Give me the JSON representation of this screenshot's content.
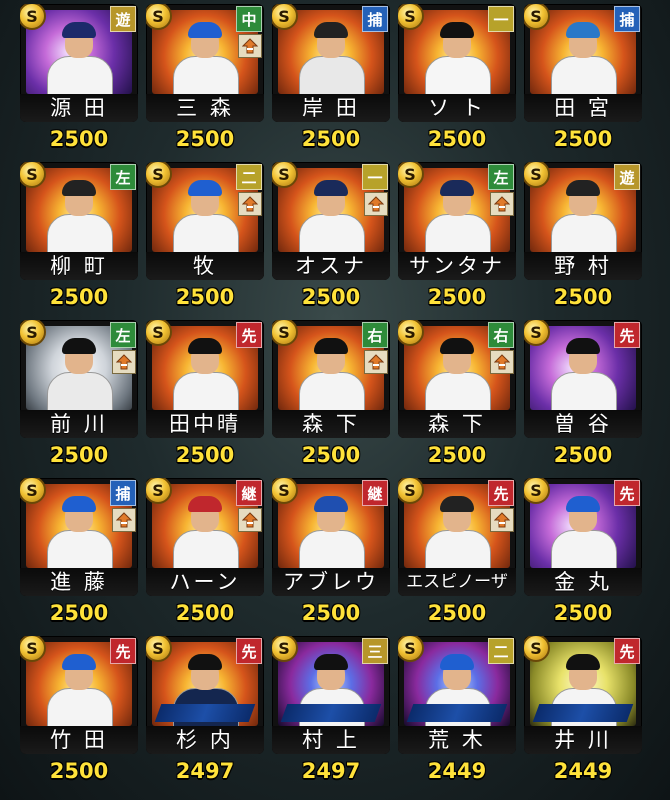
{
  "coin_symbol": "S",
  "icons": {
    "coin": "coin-s-icon",
    "upgrade": "upgrade-arrow-icon"
  },
  "colors": {
    "rating": "#ffe23a",
    "starter": "#c0272d",
    "catcher": "#2461b8",
    "outfield": "#2e8b3a",
    "infield": "#b7962a"
  },
  "players": [
    {
      "name": "源 田",
      "rating": "2500",
      "position": "遊",
      "pos_class": "shortstop",
      "bg": "purple",
      "cap": "#1c2a6a",
      "uniform": "#f4f4f4",
      "upgrade": false
    },
    {
      "name": "三 森",
      "rating": "2500",
      "position": "中",
      "pos_class": "center",
      "bg": "gold",
      "cap": "#1f5fd0",
      "uniform": "#f4f4f4",
      "upgrade": true
    },
    {
      "name": "岸 田",
      "rating": "2500",
      "position": "捕",
      "pos_class": "catcher",
      "bg": "gold",
      "cap": "#222",
      "uniform": "#e8e8e8",
      "upgrade": false
    },
    {
      "name": "ソ ト",
      "rating": "2500",
      "position": "一",
      "pos_class": "first",
      "bg": "gold",
      "cap": "#111",
      "uniform": "#f6f6f6",
      "upgrade": false
    },
    {
      "name": "田 宮",
      "rating": "2500",
      "position": "捕",
      "pos_class": "catcher",
      "bg": "gold",
      "cap": "#2a78c8",
      "uniform": "#f4f4f4",
      "upgrade": false
    },
    {
      "name": "柳 町",
      "rating": "2500",
      "position": "左",
      "pos_class": "left",
      "bg": "gold",
      "cap": "#222",
      "uniform": "#f4f4f4",
      "upgrade": false
    },
    {
      "name": "牧",
      "rating": "2500",
      "position": "二",
      "pos_class": "second",
      "bg": "gold",
      "cap": "#1f5fd0",
      "uniform": "#f4f4f4",
      "upgrade": true
    },
    {
      "name": "オスナ",
      "rating": "2500",
      "position": "一",
      "pos_class": "first",
      "bg": "gold",
      "cap": "#1a2a5a",
      "uniform": "#f4f4f4",
      "upgrade": true
    },
    {
      "name": "サンタナ",
      "rating": "2500",
      "position": "左",
      "pos_class": "left",
      "bg": "gold",
      "cap": "#1a2a5a",
      "uniform": "#f4f4f4",
      "upgrade": true
    },
    {
      "name": "野 村",
      "rating": "2500",
      "position": "遊",
      "pos_class": "shortstop",
      "bg": "gold",
      "cap": "#222",
      "uniform": "#f4f4f4",
      "upgrade": false
    },
    {
      "name": "前 川",
      "rating": "2500",
      "position": "左",
      "pos_class": "left",
      "bg": "silver",
      "cap": "#111",
      "uniform": "#eaeaea",
      "upgrade": true
    },
    {
      "name": "田中晴",
      "rating": "2500",
      "position": "先",
      "pos_class": "starter",
      "bg": "gold",
      "cap": "#111",
      "uniform": "#f4f4f4",
      "upgrade": false
    },
    {
      "name": "森 下",
      "rating": "2500",
      "position": "右",
      "pos_class": "right",
      "bg": "gold",
      "cap": "#111",
      "uniform": "#f4f4f4",
      "upgrade": true
    },
    {
      "name": "森 下",
      "rating": "2500",
      "position": "右",
      "pos_class": "right",
      "bg": "gold",
      "cap": "#111",
      "uniform": "#f4f4f4",
      "upgrade": true
    },
    {
      "name": "曽 谷",
      "rating": "2500",
      "position": "先",
      "pos_class": "starter",
      "bg": "purple",
      "cap": "#111",
      "uniform": "#f4f4f4",
      "upgrade": false
    },
    {
      "name": "進 藤",
      "rating": "2500",
      "position": "捕",
      "pos_class": "catcher",
      "bg": "gold",
      "cap": "#1f5fd0",
      "uniform": "#f4f4f4",
      "upgrade": true
    },
    {
      "name": "ハーン",
      "rating": "2500",
      "position": "継",
      "pos_class": "relief",
      "bg": "gold",
      "cap": "#c0272d",
      "uniform": "#f4f4f4",
      "upgrade": true
    },
    {
      "name": "アブレウ",
      "rating": "2500",
      "position": "継",
      "pos_class": "relief",
      "bg": "gold",
      "cap": "#1f4fb0",
      "uniform": "#f4f4f4",
      "upgrade": false
    },
    {
      "name": "エスピノーザ",
      "rating": "2500",
      "position": "先",
      "pos_class": "starter",
      "bg": "gold",
      "cap": "#222",
      "uniform": "#f4f4f4",
      "upgrade": true
    },
    {
      "name": "金 丸",
      "rating": "2500",
      "position": "先",
      "pos_class": "starter",
      "bg": "purple",
      "cap": "#1f5fd0",
      "uniform": "#f4f4f4",
      "upgrade": false
    },
    {
      "name": "竹 田",
      "rating": "2500",
      "position": "先",
      "pos_class": "starter",
      "bg": "gold",
      "cap": "#1f5fd0",
      "uniform": "#f4f4f4",
      "upgrade": false
    },
    {
      "name": "杉 内",
      "rating": "2497",
      "position": "先",
      "pos_class": "starter",
      "bg": "gold",
      "cap": "#111",
      "uniform": "#14264f",
      "upgrade": false
    },
    {
      "name": "村 上",
      "rating": "2497",
      "position": "三",
      "pos_class": "third",
      "bg": "galaxy",
      "cap": "#111",
      "uniform": "#f4f4f4",
      "upgrade": false
    },
    {
      "name": "荒 木",
      "rating": "2449",
      "position": "二",
      "pos_class": "second",
      "bg": "galaxy",
      "cap": "#1f5fd0",
      "uniform": "#f4f4f4",
      "upgrade": false
    },
    {
      "name": "井 川",
      "rating": "2449",
      "position": "先",
      "pos_class": "starter",
      "bg": "yellow",
      "cap": "#111",
      "uniform": "#f4f4f4",
      "upgrade": false
    }
  ]
}
